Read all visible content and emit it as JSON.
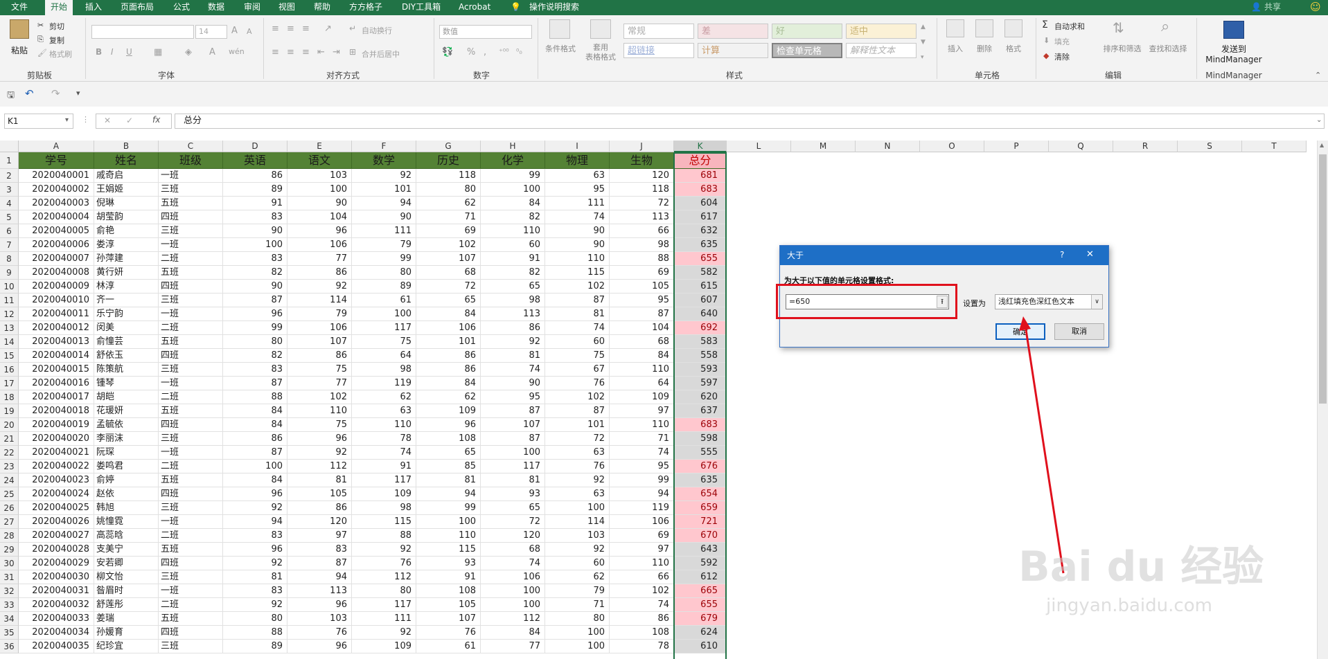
{
  "menu": {
    "tabs": [
      "文件",
      "开始",
      "插入",
      "页面布局",
      "公式",
      "数据",
      "审阅",
      "视图",
      "帮助",
      "方方格子",
      "DIY工具箱",
      "Acrobat"
    ],
    "active_tab": "开始",
    "tell_me": "操作说明搜索",
    "share": "共享"
  },
  "ribbon": {
    "clipboard": {
      "paste": "粘贴",
      "cut": "剪切",
      "copy": "复制",
      "format_painter": "格式刷",
      "label": "剪贴板"
    },
    "font": {
      "size": "14",
      "bold": "B",
      "italic": "I",
      "underline": "U",
      "grow": "A",
      "shrink": "A",
      "wen": "wén",
      "label": "字体"
    },
    "alignment": {
      "wrap": "自动换行",
      "merge": "合并后居中",
      "label": "对齐方式"
    },
    "number": {
      "format": "数值",
      "percent": "%",
      "comma": ",",
      "label": "数字"
    },
    "styles": {
      "cond_format": "条件格式",
      "table_format": "套用\n表格格式",
      "normal": "常规",
      "bad": "差",
      "good": "好",
      "neutral": "适中",
      "hyperlink": "超链接",
      "calc": "计算",
      "check": "检查单元格",
      "explain": "解释性文本",
      "label": "样式"
    },
    "cells": {
      "insert": "插入",
      "delete": "删除",
      "format": "格式",
      "label": "单元格"
    },
    "editing": {
      "autosum": "自动求和",
      "fill": "填充",
      "clear": "清除",
      "sort": "排序和筛选",
      "find": "查找和选择",
      "label": "编辑"
    },
    "mindmanager": {
      "send": "发送到\nMindManager",
      "label": "MindManager"
    }
  },
  "formula_bar": {
    "name_box": "K1",
    "fx": "fx",
    "value": "总分"
  },
  "columns": [
    "A",
    "B",
    "C",
    "D",
    "E",
    "F",
    "G",
    "H",
    "I",
    "J",
    "K",
    "L",
    "M",
    "N",
    "O",
    "P",
    "Q",
    "R",
    "S",
    "T"
  ],
  "table": {
    "headers": [
      "学号",
      "姓名",
      "班级",
      "英语",
      "语文",
      "数学",
      "历史",
      "化学",
      "物理",
      "生物",
      "总分"
    ],
    "rows": [
      [
        "2020040001",
        "戚奇启",
        "一班",
        "86",
        "103",
        "92",
        "118",
        "99",
        "63",
        "120",
        "681"
      ],
      [
        "2020040002",
        "王娟姬",
        "三班",
        "89",
        "100",
        "101",
        "80",
        "100",
        "95",
        "118",
        "683"
      ],
      [
        "2020040003",
        "倪琳",
        "五班",
        "91",
        "90",
        "94",
        "62",
        "84",
        "111",
        "72",
        "604"
      ],
      [
        "2020040004",
        "胡莹韵",
        "四班",
        "83",
        "104",
        "90",
        "71",
        "82",
        "74",
        "113",
        "617"
      ],
      [
        "2020040005",
        "俞艳",
        "三班",
        "90",
        "96",
        "111",
        "69",
        "110",
        "90",
        "66",
        "632"
      ],
      [
        "2020040006",
        "娄淳",
        "一班",
        "100",
        "106",
        "79",
        "102",
        "60",
        "90",
        "98",
        "635"
      ],
      [
        "2020040007",
        "孙萍建",
        "二班",
        "83",
        "77",
        "99",
        "107",
        "91",
        "110",
        "88",
        "655"
      ],
      [
        "2020040008",
        "黄行妍",
        "五班",
        "82",
        "86",
        "80",
        "68",
        "82",
        "115",
        "69",
        "582"
      ],
      [
        "2020040009",
        "林淳",
        "四班",
        "90",
        "92",
        "89",
        "72",
        "65",
        "102",
        "105",
        "615"
      ],
      [
        "2020040010",
        "齐一",
        "三班",
        "87",
        "114",
        "61",
        "65",
        "98",
        "87",
        "95",
        "607"
      ],
      [
        "2020040011",
        "乐宁韵",
        "一班",
        "96",
        "79",
        "100",
        "84",
        "113",
        "81",
        "87",
        "640"
      ],
      [
        "2020040012",
        "闵美",
        "二班",
        "99",
        "106",
        "117",
        "106",
        "86",
        "74",
        "104",
        "692"
      ],
      [
        "2020040013",
        "俞憧芸",
        "五班",
        "80",
        "107",
        "75",
        "101",
        "92",
        "60",
        "68",
        "583"
      ],
      [
        "2020040014",
        "舒依玉",
        "四班",
        "82",
        "86",
        "64",
        "86",
        "81",
        "75",
        "84",
        "558"
      ],
      [
        "2020040015",
        "陈策航",
        "三班",
        "83",
        "75",
        "98",
        "86",
        "74",
        "67",
        "110",
        "593"
      ],
      [
        "2020040016",
        "锺琴",
        "一班",
        "87",
        "77",
        "119",
        "84",
        "90",
        "76",
        "64",
        "597"
      ],
      [
        "2020040017",
        "胡皑",
        "二班",
        "88",
        "102",
        "62",
        "62",
        "95",
        "102",
        "109",
        "620"
      ],
      [
        "2020040018",
        "花瑗妍",
        "五班",
        "84",
        "110",
        "63",
        "109",
        "87",
        "87",
        "97",
        "637"
      ],
      [
        "2020040019",
        "孟毓依",
        "四班",
        "84",
        "75",
        "110",
        "96",
        "107",
        "101",
        "110",
        "683"
      ],
      [
        "2020040020",
        "李丽沫",
        "三班",
        "86",
        "96",
        "78",
        "108",
        "87",
        "72",
        "71",
        "598"
      ],
      [
        "2020040021",
        "阮琛",
        "一班",
        "87",
        "92",
        "74",
        "65",
        "100",
        "63",
        "74",
        "555"
      ],
      [
        "2020040022",
        "娄鸣君",
        "二班",
        "100",
        "112",
        "91",
        "85",
        "117",
        "76",
        "95",
        "676"
      ],
      [
        "2020040023",
        "俞婷",
        "五班",
        "84",
        "81",
        "117",
        "81",
        "81",
        "92",
        "99",
        "635"
      ],
      [
        "2020040024",
        "赵依",
        "四班",
        "96",
        "105",
        "109",
        "94",
        "93",
        "63",
        "94",
        "654"
      ],
      [
        "2020040025",
        "韩旭",
        "三班",
        "92",
        "86",
        "98",
        "99",
        "65",
        "100",
        "119",
        "659"
      ],
      [
        "2020040026",
        "姚憧霓",
        "一班",
        "94",
        "120",
        "115",
        "100",
        "72",
        "114",
        "106",
        "721"
      ],
      [
        "2020040027",
        "高蕊晗",
        "二班",
        "83",
        "97",
        "88",
        "110",
        "120",
        "103",
        "69",
        "670"
      ],
      [
        "2020040028",
        "支美宁",
        "五班",
        "96",
        "83",
        "92",
        "115",
        "68",
        "92",
        "97",
        "643"
      ],
      [
        "2020040029",
        "安若卿",
        "四班",
        "92",
        "87",
        "76",
        "93",
        "74",
        "60",
        "110",
        "592"
      ],
      [
        "2020040030",
        "柳文怡",
        "三班",
        "81",
        "94",
        "112",
        "91",
        "106",
        "62",
        "66",
        "612"
      ],
      [
        "2020040031",
        "昝眉时",
        "一班",
        "83",
        "113",
        "80",
        "108",
        "100",
        "79",
        "102",
        "665"
      ],
      [
        "2020040032",
        "舒莲彤",
        "二班",
        "92",
        "96",
        "117",
        "105",
        "100",
        "71",
        "74",
        "655"
      ],
      [
        "2020040033",
        "姜瑞",
        "五班",
        "80",
        "103",
        "111",
        "107",
        "112",
        "80",
        "86",
        "679"
      ],
      [
        "2020040034",
        "孙媛育",
        "四班",
        "88",
        "76",
        "92",
        "76",
        "84",
        "100",
        "108",
        "624"
      ],
      [
        "2020040035",
        "纪珍宜",
        "三班",
        "89",
        "96",
        "109",
        "61",
        "77",
        "100",
        "78",
        "610"
      ]
    ]
  },
  "dialog": {
    "title": "大于",
    "help": "?",
    "close": "✕",
    "prompt": "为大于以下值的单元格设置格式:",
    "value": "=650",
    "set_as": "设置为",
    "format_option": "浅红填充色深红色文本",
    "ok": "确定",
    "cancel": "取消",
    "threshold": 650
  },
  "watermark": {
    "brand": "Bai du 经验",
    "url": "jingyan.baidu.com"
  },
  "colors": {
    "excel_green": "#217346",
    "header_fill": "#548235",
    "highlight_fill": "#ffc7ce",
    "highlight_text": "#9c0006",
    "annotation_red": "#e0101c"
  }
}
